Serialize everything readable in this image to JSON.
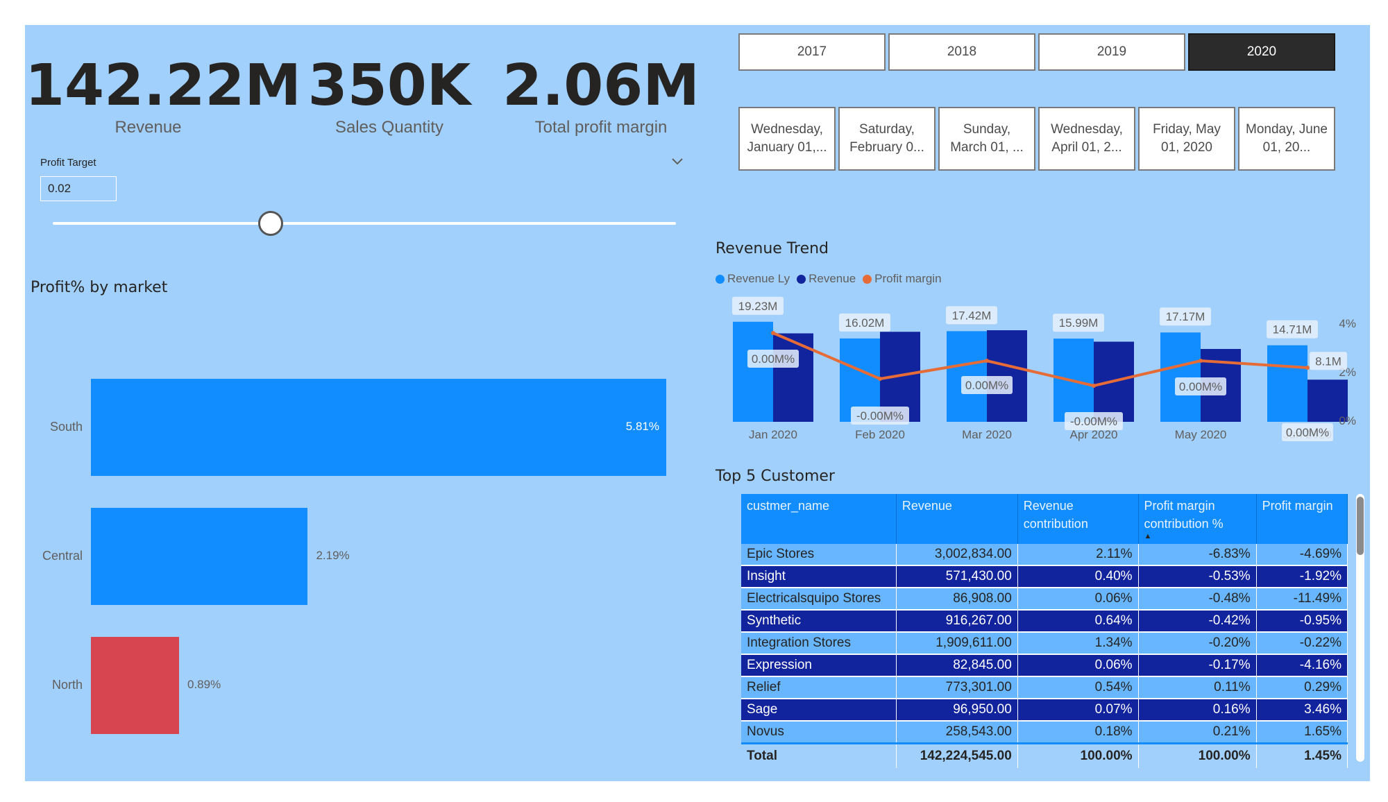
{
  "kpis": [
    {
      "value": "142.22M",
      "label": "Revenue"
    },
    {
      "value": "350K",
      "label": "Sales Quantity"
    },
    {
      "value": "2.06M",
      "label": "Total profit margin"
    }
  ],
  "profit_target": {
    "label": "Profit Target",
    "value": "0.02",
    "slider_fraction": 0.35
  },
  "years": {
    "options": [
      "2017",
      "2018",
      "2019",
      "2020"
    ],
    "selected": "2020"
  },
  "dates": [
    "Wednesday, January 01,...",
    "Saturday, February 0...",
    "Sunday, March 01, ...",
    "Wednesday, April 01, 2...",
    "Friday, May 01, 2020",
    "Monday, June 01, 20..."
  ],
  "colors": {
    "canvas": "#a2d0fc",
    "revenue_ly": "#118dff",
    "revenue": "#12239e",
    "profit_margin": "#e66c37",
    "bar": "#118dff",
    "bar_negative": "#d64550"
  },
  "market_chart": {
    "title": "Profit% by market",
    "chart_data": {
      "type": "bar",
      "orientation": "horizontal",
      "categories": [
        "South",
        "Central",
        "North"
      ],
      "values": [
        5.81,
        2.19,
        0.89
      ],
      "value_labels": [
        "5.81%",
        "2.19%",
        "0.89%"
      ],
      "value_label_position": [
        "inside",
        "outside",
        "outside"
      ],
      "bar_colors": [
        "#118dff",
        "#118dff",
        "#d64550"
      ],
      "xlim": [
        0,
        5.81
      ]
    }
  },
  "revenue_trend": {
    "title": "Revenue Trend",
    "legend": [
      {
        "name": "Revenue Ly",
        "color": "#118dff"
      },
      {
        "name": "Revenue",
        "color": "#12239e"
      },
      {
        "name": "Profit margin",
        "color": "#e66c37"
      }
    ],
    "chart_data": {
      "type": "bar",
      "categories": [
        "Jan 2020",
        "Feb 2020",
        "Mar 2020",
        "Apr 2020",
        "May 2020",
        "Jun 2020"
      ],
      "series": [
        {
          "name": "Revenue Ly",
          "values": [
            19.23,
            16.02,
            17.42,
            15.99,
            17.17,
            14.71
          ],
          "labels": [
            "19.23M",
            "16.02M",
            "17.42M",
            "15.99M",
            "17.17M",
            "14.71M"
          ]
        },
        {
          "name": "Revenue",
          "values": [
            17.0,
            17.3,
            17.6,
            15.4,
            14.0,
            8.1
          ],
          "labels": [
            "",
            "",
            "",
            "",
            "",
            "8.1M"
          ]
        }
      ],
      "line_series": {
        "name": "Profit margin",
        "values": [
          3.0,
          -0.3,
          1.0,
          -0.8,
          1.0,
          0.5
        ],
        "labels": [
          "0.00M%",
          "-0.00M%",
          "0.00M%",
          "-0.00M%",
          "0.00M%",
          "0.00M%"
        ]
      },
      "ylim_bars": [
        0,
        20
      ],
      "ylim_secondary": [
        -2,
        4
      ],
      "secondary_ticks": [
        "4%",
        "2%",
        "0%"
      ]
    }
  },
  "customers": {
    "title": "Top 5 Customer",
    "columns": [
      "custmer_name",
      "Revenue",
      "Revenue contribution",
      "Profit margin contribution %",
      "Profit margin"
    ],
    "rows": [
      [
        "Epic Stores",
        "3,002,834.00",
        "2.11%",
        "-6.83%",
        "-4.69%"
      ],
      [
        "Insight",
        "571,430.00",
        "0.40%",
        "-0.53%",
        "-1.92%"
      ],
      [
        "Electricalsquipo Stores",
        "86,908.00",
        "0.06%",
        "-0.48%",
        "-11.49%"
      ],
      [
        "Synthetic",
        "916,267.00",
        "0.64%",
        "-0.42%",
        "-0.95%"
      ],
      [
        "Integration Stores",
        "1,909,611.00",
        "1.34%",
        "-0.20%",
        "-0.22%"
      ],
      [
        "Expression",
        "82,845.00",
        "0.06%",
        "-0.17%",
        "-4.16%"
      ],
      [
        "Relief",
        "773,301.00",
        "0.54%",
        "0.11%",
        "0.29%"
      ],
      [
        "Sage",
        "96,950.00",
        "0.07%",
        "0.16%",
        "3.46%"
      ],
      [
        "Novus",
        "258,543.00",
        "0.18%",
        "0.21%",
        "1.65%"
      ]
    ],
    "total": [
      "Total",
      "142,224,545.00",
      "100.00%",
      "100.00%",
      "1.45%"
    ]
  }
}
